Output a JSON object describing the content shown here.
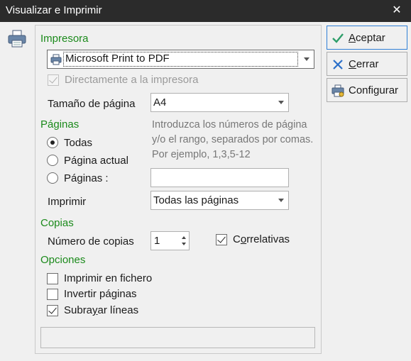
{
  "window": {
    "title": "Visualizar e Imprimir",
    "close_glyph": "✕"
  },
  "impresora": {
    "section_label": "Impresora",
    "printer_selected": "Microsoft Print to PDF",
    "direct_checkbox": {
      "label": "Directamente a la impresora",
      "checked": true,
      "enabled": false
    }
  },
  "tamano": {
    "label": "Tamaño de página",
    "selected": "A4"
  },
  "paginas": {
    "section_label": "Páginas",
    "options": [
      {
        "label": "Todas",
        "selected": true
      },
      {
        "label": "Página actual",
        "selected": false
      },
      {
        "label": "Páginas :",
        "selected": false
      }
    ],
    "hint": "Introduzca los números de página y/o el rango, separados por comas. Por ejemplo, 1,3,5-12",
    "range_value": "",
    "imprimir_label": "Imprimir",
    "imprimir_selected": "Todas las páginas"
  },
  "copias": {
    "section_label": "Copias",
    "count_label": "Número de copias",
    "count_value": "1",
    "collate": {
      "label_pre": "C",
      "label_ul": "o",
      "label_post": "rrelativas",
      "checked": true
    }
  },
  "opciones": {
    "section_label": "Opciones",
    "items": [
      {
        "label": "Imprimir en fichero",
        "checked": false
      },
      {
        "label": "Invertir páginas",
        "checked": false
      },
      {
        "label_pre": "Subra",
        "label_ul": "y",
        "label_post": "ar líneas",
        "checked": true
      }
    ]
  },
  "buttons": {
    "aceptar": {
      "ul": "A",
      "rest": "ceptar"
    },
    "cerrar": {
      "ul": "C",
      "rest": "errar"
    },
    "configurar": {
      "label": "Configurar"
    }
  },
  "colors": {
    "section": "#1b8a1b",
    "title_bar": "#2b2b2b",
    "accept_check": "#2e9e6a",
    "close_x": "#2a6fc9",
    "focus_border": "#2f7fd6"
  },
  "icons": {
    "side": "printer-icon",
    "combo": "printer-icon",
    "accept": "checkmark-icon",
    "close": "close-x-icon",
    "configure": "printer-settings-icon"
  }
}
